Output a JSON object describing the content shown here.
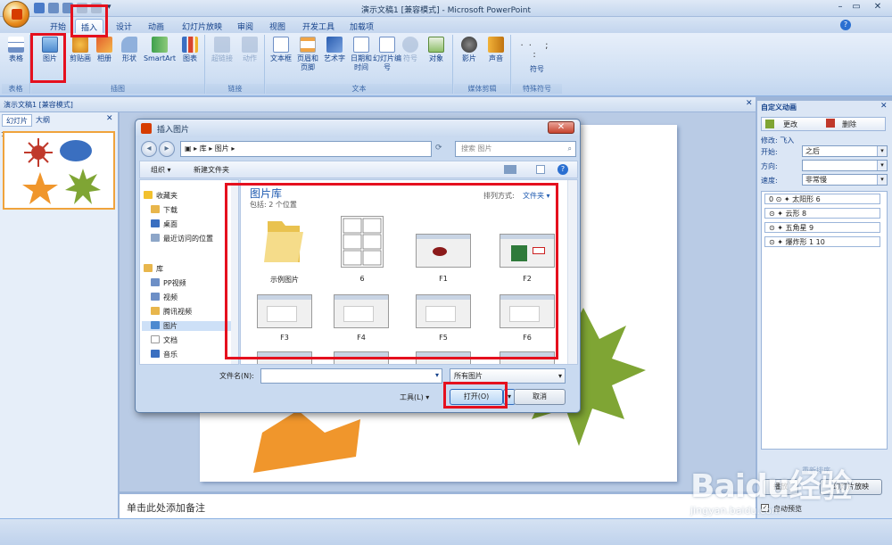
{
  "window": {
    "title": "演示文稿1 [兼容模式] - Microsoft PowerPoint",
    "controls": [
      "–",
      "▭",
      "✕"
    ]
  },
  "qat": {
    "more": "▾"
  },
  "ribbon": {
    "tabs": [
      "开始",
      "插入",
      "设计",
      "动画",
      "幻灯片放映",
      "审阅",
      "视图",
      "开发工具",
      "加载项"
    ],
    "active_tab": "插入",
    "help": "?",
    "groups": [
      {
        "label": "表格",
        "buttons": [
          "表格"
        ]
      },
      {
        "label": "插图",
        "buttons": [
          "图片",
          "剪贴画",
          "相册",
          "形状",
          "SmartArt",
          "图表"
        ]
      },
      {
        "label": "链接",
        "buttons": [
          "超链接",
          "动作"
        ]
      },
      {
        "label": "文本",
        "buttons": [
          "文本框",
          "页眉和页脚",
          "艺术字",
          "日期和时间",
          "幻灯片编号",
          "符号",
          "对象"
        ]
      },
      {
        "label": "媒体剪辑",
        "buttons": [
          "影片",
          "声音"
        ]
      },
      {
        "label": "特殊符号",
        "buttons": [
          "符号"
        ]
      }
    ]
  },
  "doc_tab": {
    "label": "演示文稿1 [兼容模式]"
  },
  "left_panel": {
    "tabs": [
      "幻灯片",
      "大纲"
    ],
    "close": "✕",
    "slide_number": "1"
  },
  "notes": {
    "placeholder": "单击此处添加备注"
  },
  "task_pane": {
    "title": "自定义动画",
    "change_btn": "更改",
    "delete_btn": "删除",
    "modify_label": "修改: 飞入",
    "start_label": "开始:",
    "start_value": "之后",
    "direction_label": "方向:",
    "direction_value": "",
    "speed_label": "速度:",
    "speed_value": "非常慢",
    "items": [
      {
        "index": "0",
        "name": "太阳形 6"
      },
      {
        "index": "",
        "name": "云形 8"
      },
      {
        "index": "",
        "name": "五角星 9"
      },
      {
        "index": "",
        "name": "爆炸形 1 10"
      }
    ],
    "reorder_label": "重新排序",
    "play_btn": "播放",
    "slideshow_btn": "幻灯片放映",
    "autopreview_label": "自动预览"
  },
  "dialog": {
    "title": "插入图片",
    "close": "✕",
    "breadcrumb": [
      "库",
      "图片"
    ],
    "search_placeholder": "搜索 图片",
    "organize": "组织 ▾",
    "new_folder": "新建文件夹",
    "nav": {
      "favorites": "收藏夹",
      "downloads": "下载",
      "desktop": "桌面",
      "recent": "最近访问的位置",
      "libraries": "库",
      "pp_video": "PP视频",
      "video": "视频",
      "tencent_video": "腾讯视频",
      "pictures": "图片",
      "documents": "文档",
      "music": "音乐"
    },
    "library_title": "图片库",
    "library_includes": "包括: 2 个位置",
    "sort_label": "排列方式:",
    "sort_value": "文件夹 ▾",
    "items": [
      "示例图片",
      "6",
      "F1",
      "F2",
      "F3",
      "F4",
      "F5",
      "F6"
    ],
    "filename_label": "文件名(N):",
    "filename_value": "",
    "filetype_value": "所有图片",
    "tools_label": "工具(L)",
    "open_btn": "打开(O)",
    "cancel_btn": "取消"
  },
  "watermark": {
    "text": "Baidu经验",
    "url": "jingyan.baidu.com"
  },
  "colors": {
    "highlight": "#e5101e",
    "ribbon": "#dbe6f5",
    "accent": "#15428b"
  }
}
